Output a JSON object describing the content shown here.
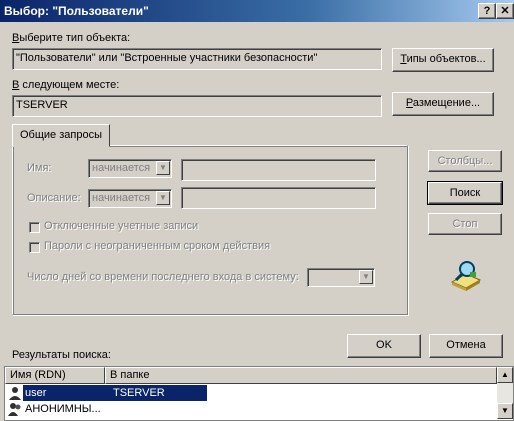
{
  "window": {
    "title": "Выбор: \"Пользователи\"",
    "help_button": "?",
    "close_button": "✕"
  },
  "object_type": {
    "label_prefix": "В",
    "label_rest": "ыберите тип объекта:",
    "value": "\"Пользователи\" или \"Встроенные участники безопасности\"",
    "button_u": "Т",
    "button_rest": "ипы объектов..."
  },
  "location": {
    "label_prefix": "В",
    "label_rest": " следующем месте:",
    "value": "TSERVER",
    "button_u": "Р",
    "button_rest": "азмещение..."
  },
  "tab": {
    "label": "Общие запросы"
  },
  "query": {
    "name_label": "Имя:",
    "name_mode": "начинается",
    "desc_label": "Описание:",
    "desc_mode": "начинается",
    "disabled_accounts": "Отключенные учетные записи",
    "no_expire_passwords": "Пароли с неограниченным сроком действия",
    "days_label": "Число дней со времени последнего входа в систему:"
  },
  "side_buttons": {
    "columns": "Столбцы...",
    "search": "Поиск",
    "stop": "Стоп"
  },
  "results": {
    "label": "Результаты поиска:",
    "columns": [
      "Имя (RDN)",
      "В папке"
    ],
    "rows": [
      {
        "name": "user",
        "folder": "TSERVER",
        "icon": "user-icon",
        "selected": true
      },
      {
        "name": "АНОНИМНЫ...",
        "folder": "",
        "icon": "group-icon",
        "selected": false
      }
    ]
  },
  "footer": {
    "ok": "OK",
    "cancel": "Отмена"
  },
  "colors": {
    "titlebar_start": "#0a246a",
    "titlebar_end": "#a6caf0",
    "face": "#d4d0c8",
    "selection": "#0a246a"
  }
}
